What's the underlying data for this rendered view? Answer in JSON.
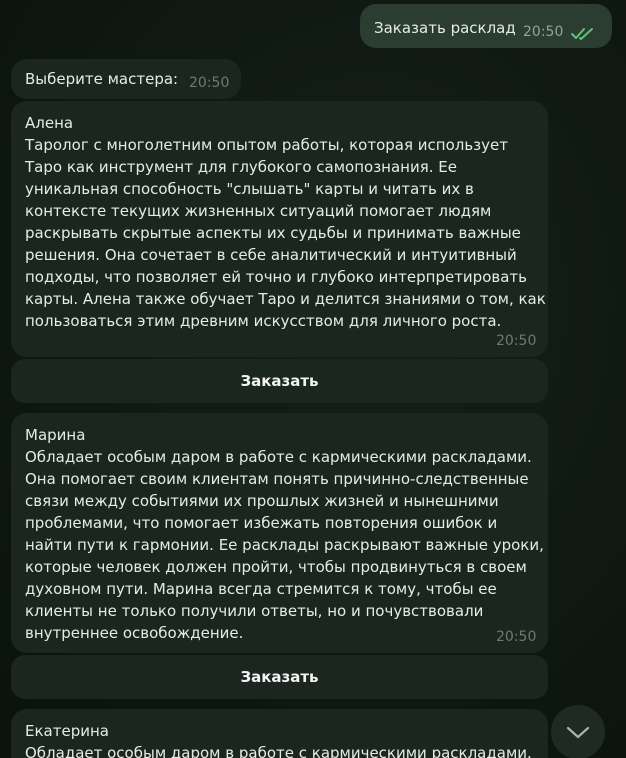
{
  "outgoing": {
    "text": "Заказать расклад",
    "time": "20:50"
  },
  "prompt": {
    "text": "Выберите мастера:",
    "time": "20:50"
  },
  "masters": [
    {
      "name": "Алена",
      "text": "Таролог с многолетним опытом работы, которая использует\nТаро как инструмент для глубокого самопознания. Ее\nуникальная способность \"слышать\" карты и читать их в\nконтексте текущих жизненных ситуаций помогает людям\nраскрывать скрытые аспекты их судьбы и принимать важные\nрешения. Она сочетает в себе аналитический и интуитивный\nподходы, что позволяет ей точно и глубоко интерпретировать\nкарты. Алена также обучает Таро и делится знаниями о том, как\nпользоваться этим древним искусством для личного роста.",
      "time": "20:50",
      "button": "Заказать"
    },
    {
      "name": "Марина",
      "text": "Обладает особым даром в работе с кармическими раскладами.\nОна помогает своим клиентам понять причинно-следственные\nсвязи между событиями их прошлых жизней и нынешними\nпроблемами, что помогает избежать повторения ошибок и\nнайти пути к гармонии. Ее расклады раскрывают важные уроки,\nкоторые человек должен пройти, чтобы продвинуться в своем\nдуховном пути. Марина всегда стремится к тому, чтобы ее\nклиенты не только получили ответы, но и почувствовали\nвнутреннее освобождение.",
      "time": "20:50",
      "button": "Заказать"
    },
    {
      "name": "Екатерина",
      "text": "Обладает особым даром в работе с кармическими раскладами."
    }
  ],
  "icons": {
    "read_status": "double-check-icon",
    "scroll_down": "chevron-down-icon"
  },
  "colors": {
    "incoming_bubble": "#1c2620",
    "outgoing_bubble": "#2a3d30",
    "check_color": "#5fc27a"
  }
}
